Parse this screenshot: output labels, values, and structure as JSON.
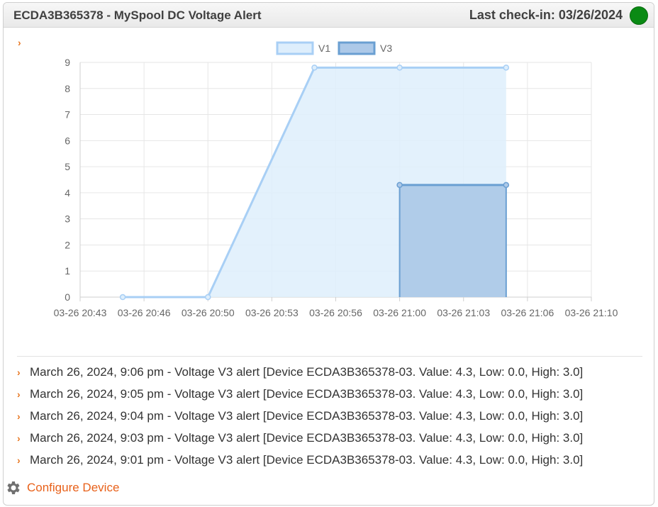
{
  "header": {
    "title": "ECDA3B365378 - MySpool DC Voltage Alert",
    "checkin": "Last check-in: 03/26/2024",
    "status_color": "#0a8a14"
  },
  "chart_data": {
    "type": "area",
    "x_ticks": [
      "03-26 20:43",
      "03-26 20:46",
      "03-26 20:50",
      "03-26 20:53",
      "03-26 20:56",
      "03-26 21:00",
      "03-26 21:03",
      "03-26 21:06",
      "03-26 21:10"
    ],
    "ylim": [
      0,
      9
    ],
    "y_ticks": [
      "0",
      "1",
      "2",
      "3",
      "4",
      "5",
      "6",
      "7",
      "8",
      "9"
    ],
    "grid": true,
    "legend": "top",
    "series": [
      {
        "name": "V1",
        "color": "#a8cff5",
        "fill": "#deeefc",
        "points": [
          {
            "x": "03-26 20:45",
            "y": 0
          },
          {
            "x": "03-26 20:50",
            "y": 0
          },
          {
            "x": "03-26 20:55",
            "y": 8.8
          },
          {
            "x": "03-26 21:00",
            "y": 8.8
          },
          {
            "x": "03-26 21:05",
            "y": 8.8
          }
        ]
      },
      {
        "name": "V3",
        "color": "#6a9fd2",
        "fill": "#adc9e8",
        "points": [
          {
            "x": "03-26 21:00",
            "y": 4.3
          },
          {
            "x": "03-26 21:05",
            "y": 4.3
          }
        ]
      }
    ]
  },
  "alerts": [
    "March 26, 2024, 9:06 pm - Voltage V3 alert [Device ECDA3B365378-03. Value: 4.3, Low: 0.0, High: 3.0]",
    "March 26, 2024, 9:05 pm - Voltage V3 alert [Device ECDA3B365378-03. Value: 4.3, Low: 0.0, High: 3.0]",
    "March 26, 2024, 9:04 pm - Voltage V3 alert [Device ECDA3B365378-03. Value: 4.3, Low: 0.0, High: 3.0]",
    "March 26, 2024, 9:03 pm - Voltage V3 alert [Device ECDA3B365378-03. Value: 4.3, Low: 0.0, High: 3.0]",
    "March 26, 2024, 9:01 pm - Voltage V3 alert [Device ECDA3B365378-03. Value: 4.3, Low: 0.0, High: 3.0]"
  ],
  "configure_label": "Configure Device",
  "icons": {
    "chevron": "chevron-right-icon",
    "gear": "gear-icon"
  }
}
